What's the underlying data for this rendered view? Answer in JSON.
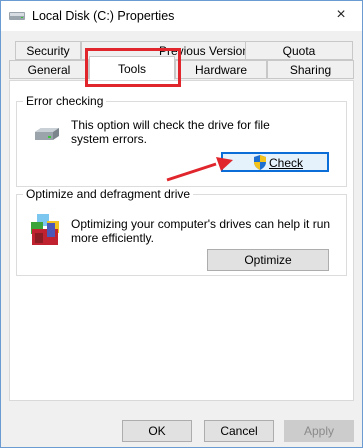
{
  "window": {
    "title": "Local Disk (C:) Properties",
    "close_glyph": "×"
  },
  "tabs": {
    "back_row": [
      "Security",
      "Previous Versions",
      "Quota"
    ],
    "front_row": [
      "General",
      "Tools",
      "Hardware",
      "Sharing"
    ],
    "active": "Tools"
  },
  "error_checking": {
    "title": "Error checking",
    "description_line1": "This option will check the drive for file",
    "description_line2": "system errors.",
    "button_label": "Check",
    "icon": "drive-icon",
    "button_icon": "shield-icon"
  },
  "optimize": {
    "title": "Optimize and defragment drive",
    "description_line1": "Optimizing your computer's drives can help it run",
    "description_line2": "more efficiently.",
    "button_label": "Optimize",
    "icon": "defrag-icon"
  },
  "footer": {
    "ok": "OK",
    "cancel": "Cancel",
    "apply": "Apply"
  },
  "annotation": {
    "highlight_color": "#e0262c",
    "arrow_color": "#e0262c"
  },
  "colors": {
    "focus_border": "#0b6dd7",
    "window_border": "#6b9bd0"
  }
}
